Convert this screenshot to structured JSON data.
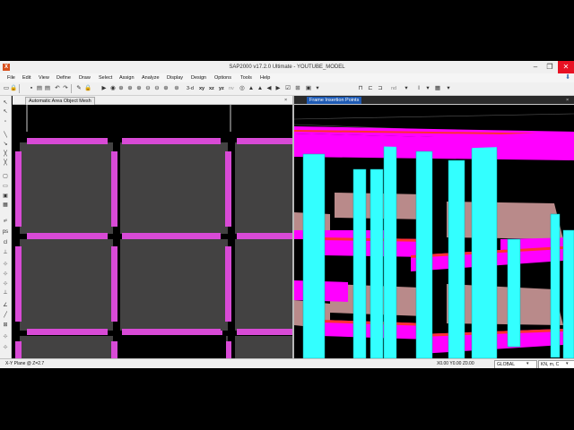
{
  "window": {
    "app_icon": "X",
    "title": "SAP2000 v17.2.0 Ultimate  -  YOUTUBE_MODEL",
    "minimize": "–",
    "restore": "❐",
    "close": "✕"
  },
  "menu": [
    "File",
    "Edit",
    "View",
    "Define",
    "Draw",
    "Select",
    "Assign",
    "Analyze",
    "Display",
    "Design",
    "Options",
    "Tools",
    "Help"
  ],
  "toolbar": {
    "view_3d": "3-d",
    "view_xy": "xy",
    "view_xz": "xz",
    "view_yz": "yz",
    "view_nv": "nv",
    "nd_label": "nd"
  },
  "panes": {
    "left_title": "Automatic Area Object Mesh",
    "left_close": "×",
    "right_title": "Frame Insertion Points",
    "right_close": "×"
  },
  "status": {
    "plane": "X-Y Plane @ Z=2.7",
    "coords": "X0.00  Y0.00  Z0.00",
    "coord_system": "GLOBAL",
    "units": "KN, m, C"
  },
  "colors": {
    "shell": "#434242",
    "beam_magenta": "#d84ad6",
    "frame_magenta": "#ff00ff",
    "column_cyan": "#33ffff",
    "slab_pink": "#b98a8a",
    "beam_red": "#ff3030",
    "active_tab": "#1e5ab4"
  }
}
